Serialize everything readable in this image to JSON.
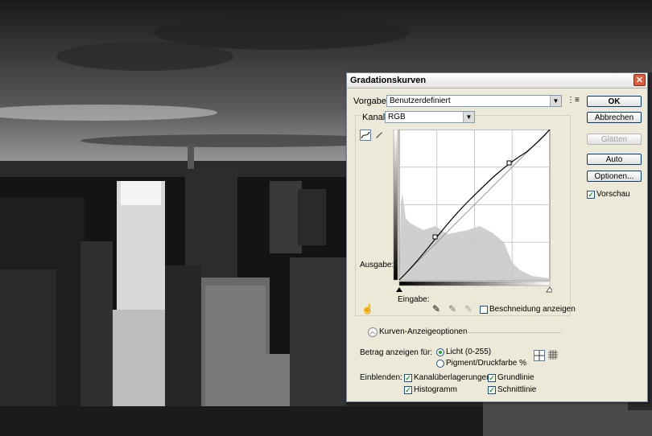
{
  "dialog": {
    "title": "Gradationskurven",
    "vorgabe_label": "Vorgabe:",
    "vorgabe_value": "Benutzerdefiniert",
    "kanal_label": "Kanal:",
    "kanal_value": "RGB",
    "ausgabe_label": "Ausgabe:",
    "eingabe_label": "Eingabe:",
    "beschneidung_label": "Beschneidung anzeigen",
    "kurven_options_label": "Kurven-Anzeigeoptionen",
    "betrag_label": "Betrag anzeigen für:",
    "radio_licht": "Licht (0-255)",
    "radio_pigment": "Pigment/Druckfarbe %",
    "einblenden_label": "Einblenden:",
    "chk_kanal": "Kanalüberlagerungen",
    "chk_grundlinie": "Grundlinie",
    "chk_histogramm": "Histogramm",
    "chk_schnittlinie": "Schnittlinie",
    "chk_vorschau": "Vorschau"
  },
  "buttons": {
    "ok": "OK",
    "abbrechen": "Abbrechen",
    "glaetten": "Glätten",
    "auto": "Auto",
    "optionen": "Optionen..."
  }
}
